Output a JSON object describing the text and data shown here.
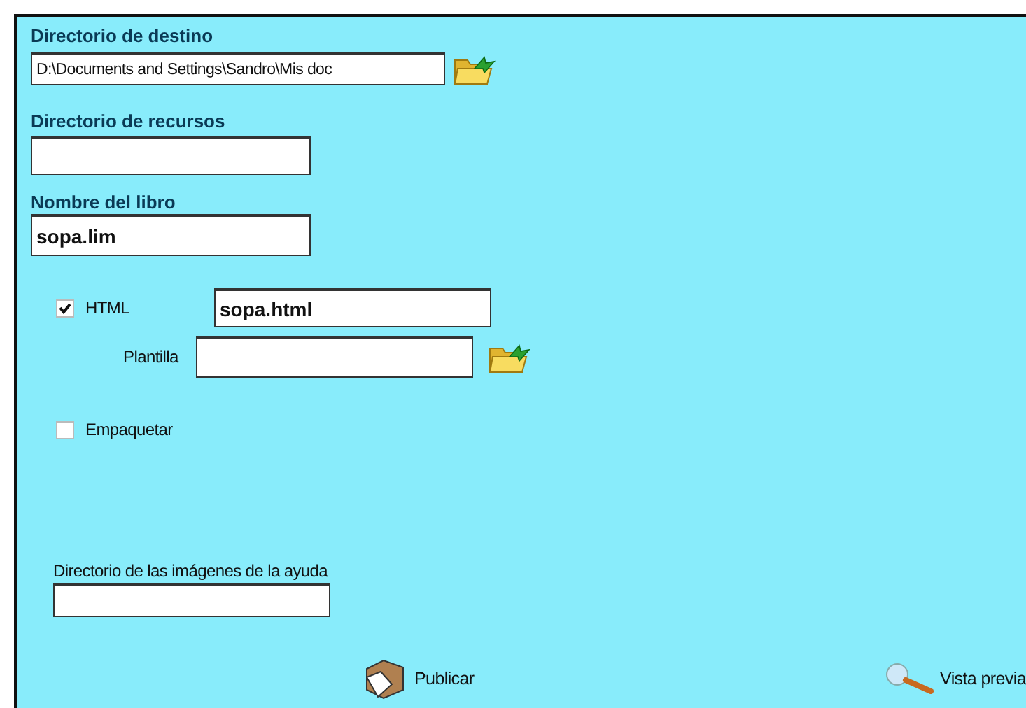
{
  "destination": {
    "label": "Directorio de destino",
    "value": "D:\\Documents and Settings\\Sandro\\Mis doc"
  },
  "resources": {
    "label": "Directorio de recursos"
  },
  "book": {
    "label": "Nombre del libro",
    "value": "sopa.lim"
  },
  "html_option": {
    "label": "HTML",
    "checked": true,
    "value": "sopa.html"
  },
  "template": {
    "label": "Plantilla"
  },
  "package": {
    "label": "Empaquetar",
    "checked": false
  },
  "help_images": {
    "label": "Directorio de las imágenes de la ayuda"
  },
  "buttons": [
    {
      "label": "Publicar",
      "kind": "publish"
    },
    {
      "label": "Vista previa",
      "kind": "preview"
    }
  ]
}
